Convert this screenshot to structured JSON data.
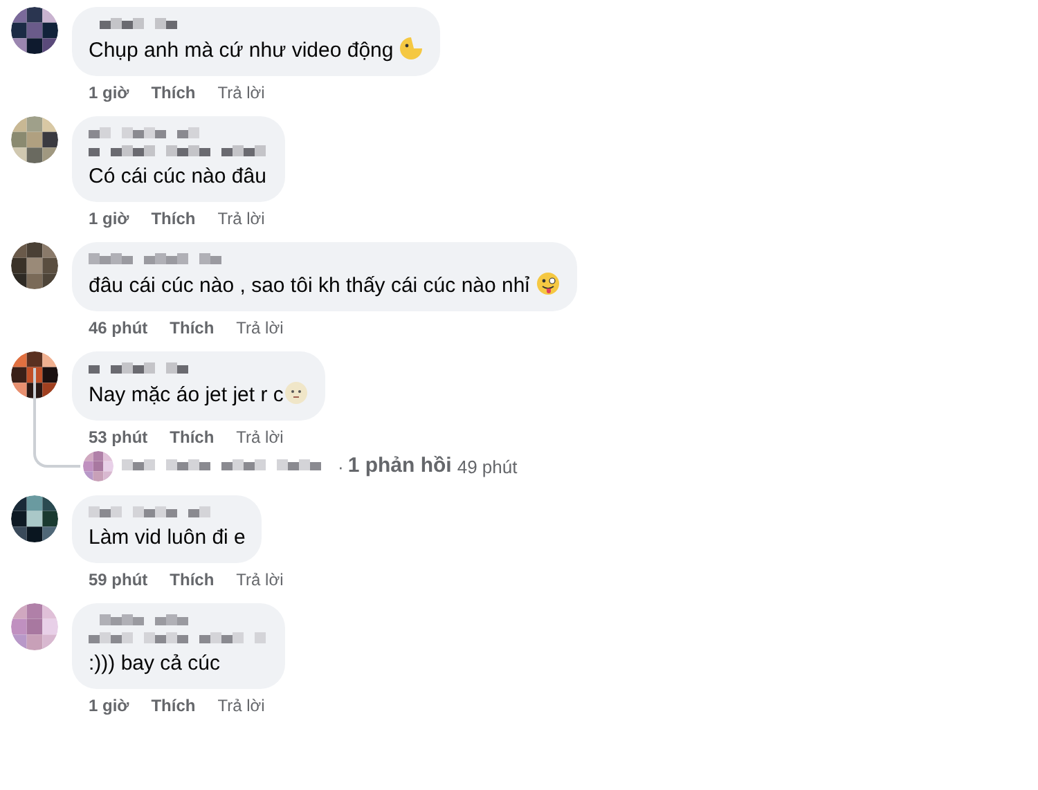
{
  "comments": [
    {
      "kind": "picture",
      "mention": false,
      "text": "Chụp anh mà cứ như video động",
      "emoji": {
        "kind": "crescent"
      },
      "time": "1 giờ",
      "like": "Thích",
      "reply": "Trả lời"
    },
    {
      "kind": "picture",
      "mention": true,
      "text": "Có cái cúc nào đâu",
      "time": "1 giờ",
      "like": "Thích",
      "reply": "Trả lời"
    },
    {
      "kind": "picture",
      "mention": false,
      "text": "đâu cái cúc nào , sao tôi kh thấy cái cúc nào nhỉ",
      "emoji": {
        "kind": "tongue"
      },
      "time": "46 phút",
      "like": "Thích",
      "reply": "Trả lời"
    },
    {
      "kind": "picture",
      "mention": false,
      "text": "Nay mặc áo jet jet r c",
      "emoji": {
        "kind": "moon-face"
      },
      "time": "53 phút",
      "like": "Thích",
      "reply": "Trả lời",
      "replies": {
        "dot": "·",
        "count": "1 phản hồi",
        "time": "49 phút"
      }
    },
    {
      "kind": "picture",
      "mention": false,
      "text": "Làm vid luôn đi e",
      "time": "59 phút",
      "like": "Thích",
      "reply": "Trả lời"
    },
    {
      "kind": "picture",
      "mention": true,
      "text": ":))) bay cả cúc",
      "time": "1 giờ",
      "like": "Thích",
      "reply": "Trả lời"
    }
  ]
}
